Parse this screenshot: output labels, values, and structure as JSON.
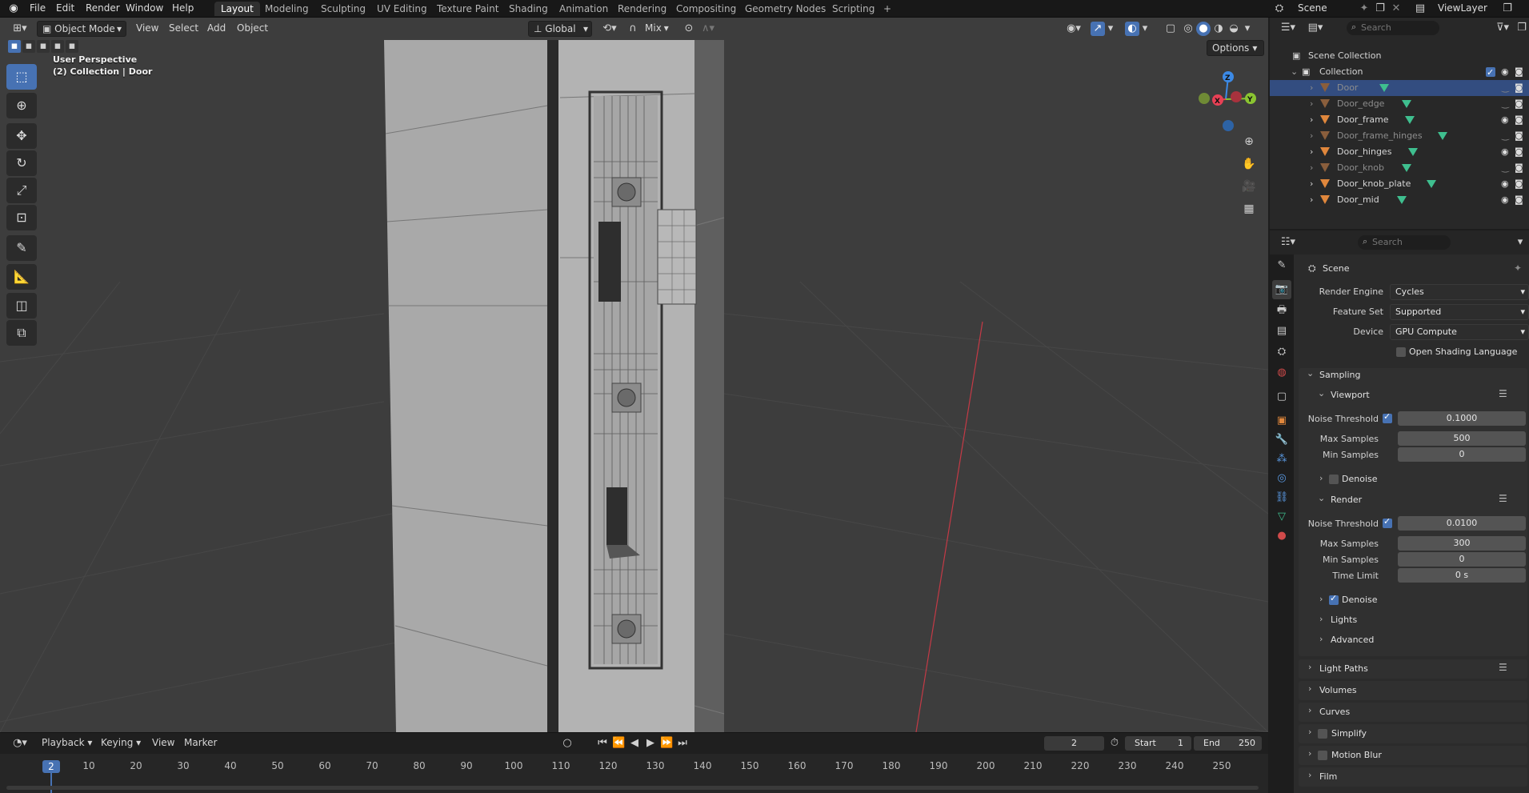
{
  "menus": [
    "File",
    "Edit",
    "Render",
    "Window",
    "Help"
  ],
  "workspaces": [
    "Layout",
    "Modeling",
    "Sculpting",
    "UV Editing",
    "Texture Paint",
    "Shading",
    "Animation",
    "Rendering",
    "Compositing",
    "Geometry Nodes",
    "Scripting",
    "+"
  ],
  "scene_name": "Scene",
  "view_layer": "ViewLayer",
  "viewport": {
    "mode": "Object Mode",
    "menus": [
      "View",
      "Select",
      "Add",
      "Object"
    ],
    "orientation": "Global",
    "snap_mode": "Mix",
    "options": "Options",
    "info_line1": "User Perspective",
    "info_line2": "(2) Collection | Door",
    "gizmo": {
      "z": "Z",
      "x": "X",
      "y": "Y"
    }
  },
  "timeline": {
    "menus": [
      "Playback",
      "Keying",
      "View",
      "Marker"
    ],
    "current_frame": "2",
    "start_label": "Start",
    "start": "1",
    "end_label": "End",
    "end": "250",
    "ruler": [
      "10",
      "20",
      "30",
      "40",
      "50",
      "60",
      "70",
      "80",
      "90",
      "100",
      "110",
      "120",
      "130",
      "140",
      "150",
      "160",
      "170",
      "180",
      "190",
      "200",
      "210",
      "220",
      "230",
      "240",
      "250"
    ]
  },
  "outliner": {
    "search_placeholder": "Search",
    "scene_collection": "Scene Collection",
    "collection": "Collection",
    "items": [
      {
        "name": "Door",
        "selected": true,
        "visible": false
      },
      {
        "name": "Door_edge",
        "selected": false,
        "visible": false
      },
      {
        "name": "Door_frame",
        "selected": false,
        "visible": true
      },
      {
        "name": "Door_frame_hinges",
        "selected": false,
        "visible": false
      },
      {
        "name": "Door_hinges",
        "selected": false,
        "visible": true
      },
      {
        "name": "Door_knob",
        "selected": false,
        "visible": false
      },
      {
        "name": "Door_knob_plate",
        "selected": false,
        "visible": true
      },
      {
        "name": "Door_mid",
        "selected": false,
        "visible": true
      }
    ]
  },
  "properties": {
    "search_placeholder": "Search",
    "context": "Scene",
    "render_engine_label": "Render Engine",
    "render_engine": "Cycles",
    "feature_set_label": "Feature Set",
    "feature_set": "Supported",
    "device_label": "Device",
    "device": "GPU Compute",
    "osl_label": "Open Shading Language",
    "sampling": "Sampling",
    "viewport": "Viewport",
    "noise_threshold_label": "Noise Threshold",
    "viewport_noise_threshold": "0.1000",
    "max_samples_label": "Max Samples",
    "viewport_max_samples": "500",
    "min_samples_label": "Min Samples",
    "viewport_min_samples": "0",
    "denoise": "Denoise",
    "render": "Render",
    "render_noise_threshold": "0.0100",
    "render_max_samples": "300",
    "render_min_samples": "0",
    "time_limit_label": "Time Limit",
    "time_limit": "0 s",
    "lights": "Lights",
    "advanced": "Advanced",
    "panels": [
      "Light Paths",
      "Volumes",
      "Curves",
      "Simplify",
      "Motion Blur",
      "Film"
    ]
  },
  "colors": {
    "accent": "#4772b3",
    "selection_row": "#334d80",
    "mesh_object": "#e0873c",
    "mesh_data": "#3fbf8f",
    "axis_x": "#e84055",
    "axis_y": "#8ac431",
    "axis_z": "#3c8ae6"
  }
}
